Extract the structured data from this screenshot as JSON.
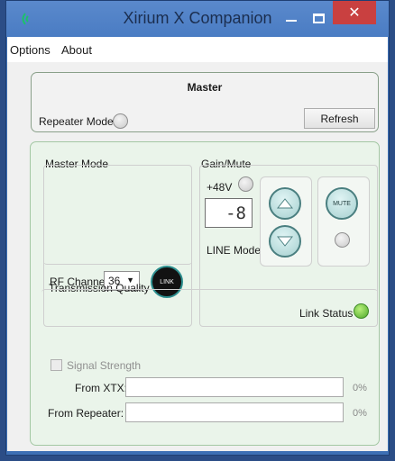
{
  "window": {
    "title": "Xirium X Companion",
    "app_icon": "wireless-signal-icon",
    "controls": {
      "close_glyph": "✕"
    }
  },
  "menu": {
    "items": [
      "Options",
      "About"
    ]
  },
  "master": {
    "title": "Master",
    "repeater_mode_label": "Repeater Mode",
    "refresh_label": "Refresh"
  },
  "master_mode": {
    "title": "Master Mode",
    "rf_channel_label": "RF Channel",
    "rf_channel_value": "36",
    "link_label": "LINK"
  },
  "gain_mute": {
    "title": "Gain/Mute",
    "phantom_label": "+48V",
    "gain_value": "-8",
    "line_mode_label": "LINE Mode",
    "mute_label": "MUTE"
  },
  "transmission": {
    "title": "Transmission Quality",
    "link_status_label": "Link Status",
    "signal_strength_label": "Signal Strength",
    "from_xtx_label": "From XTX:",
    "from_xtx_value": "0%",
    "from_xtx_level": 0,
    "from_repeater_label": "From Repeater:",
    "from_repeater_value": "0%",
    "from_repeater_level": 0
  },
  "colors": {
    "titlebar": "#4a7cc3",
    "close_button": "#c94040",
    "link_status_led": "#4ca82a",
    "panel_tint": "#eaf4ea"
  }
}
